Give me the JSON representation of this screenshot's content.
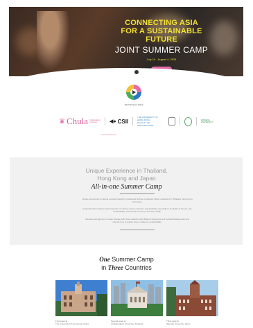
{
  "hero": {
    "line1": "CONNECTING ASIA",
    "line2": "FOR A SUSTAINABLE FUTURE",
    "line3": "JOINT SUMMER CAMP",
    "dates": "July 14 - August 4, 2024",
    "button_label": "APPLY NOW"
  },
  "logo": {
    "caption": "Joint Summer Camp"
  },
  "partners": {
    "chula": "Chula",
    "chula_sub": "Chulalongkorn University",
    "csii": "CSII",
    "hku": "THE UNIVERSITY OF HONG KONG",
    "hku_sub": "FACULTY OF ARCHITECTURE",
    "green": "WASEDA UNIVERSITY"
  },
  "intro": {
    "title_line1": "Unique Experience in Thailand,",
    "title_line2": "Hong Kong and Japan",
    "subtitle": "All-in-one Summer Camp",
    "para1": "Unique opportunity to attend courses hosted by professors at three renowned higher institutions in Thailand, Hong Kong and Japan.",
    "para2": "Understand the balance and interaction of various issues related to sustainability, especially in the fields of human, city, sustainability, and circular economy, and their health.",
    "para3": "Develop self-agency to create change with other students with different viewpoints and cultural backgrounds and discuss how to realize issues related to sustainability."
  },
  "countries": {
    "line1_italic": "One",
    "line1_rest": " Summer Camp",
    "line2_pre": "in ",
    "line2_italic": "Three",
    "line2_rest": " Countries",
    "cards": [
      {
        "caption1": "First week at",
        "caption2": "The University of Hong Kong, China"
      },
      {
        "caption1": "Second week at",
        "caption2": "Chulalongkorn University, Thailand"
      },
      {
        "caption1": "Third week at",
        "caption2": "Waseda University, Japan"
      }
    ]
  }
}
